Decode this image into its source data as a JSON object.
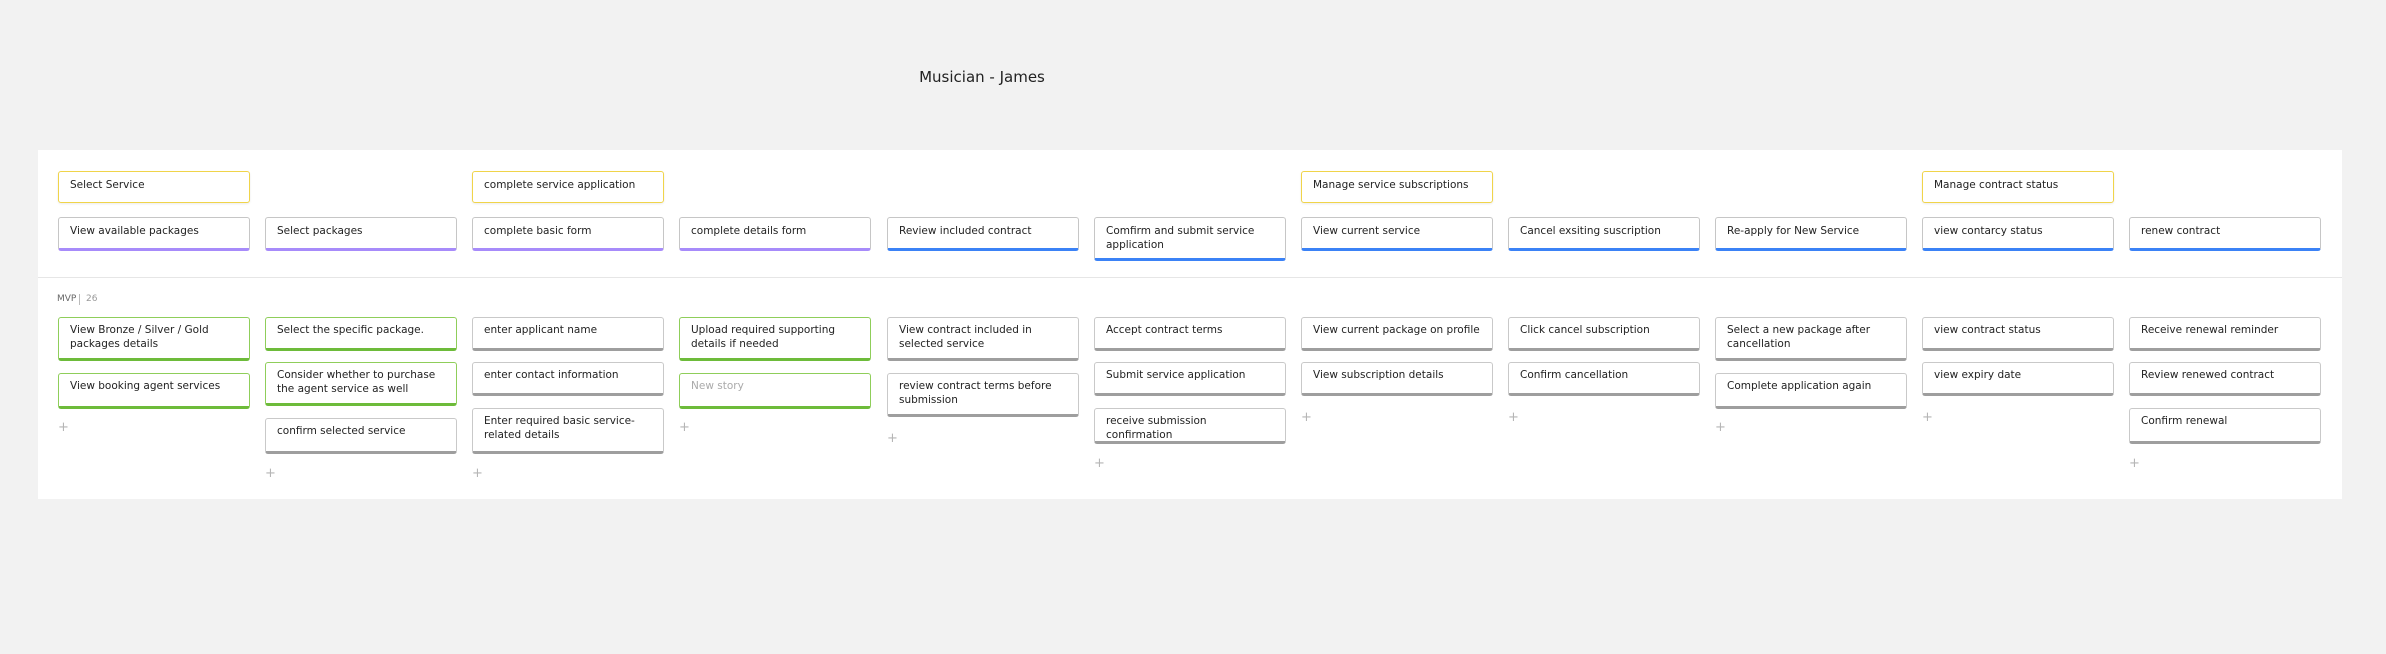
{
  "page_title": "Musician - James",
  "release": {
    "label": "MVP",
    "count": "26"
  },
  "activities": [
    "Select Service",
    "complete service application",
    "Manage service subscriptions",
    "Manage contract status"
  ],
  "steps": [
    "View available packages",
    "Select packages",
    "complete basic form",
    "complete details form",
    "Review included contract",
    "Comfirm and submit service application",
    "View current service",
    "Cancel exsiting suscription",
    "Re-apply for New Service",
    "view contarcy status",
    "renew contract"
  ],
  "stories": [
    [
      "View Bronze / Silver / Gold packages details",
      "View booking agent services"
    ],
    [
      "Select the specific package.",
      "Consider whether to purchase the agent service as well",
      "confirm selected service"
    ],
    [
      "enter applicant name",
      "enter contact information",
      "Enter required basic service-related details"
    ],
    [
      "Upload required supporting details if needed",
      "New story"
    ],
    [
      "View contract included in selected service",
      "review contract terms before submission"
    ],
    [
      "Accept contract terms",
      "Submit service application",
      "receive submission confirmation"
    ],
    [
      "View current package on profile",
      "View subscription details"
    ],
    [
      "Click cancel subscription",
      "Confirm cancellation"
    ],
    [
      "Select a new package after cancellation",
      "Complete application again"
    ],
    [
      "view contract status",
      "view expiry date"
    ],
    [
      "Receive renewal reminder",
      "Review renewed contract",
      "Confirm renewal"
    ]
  ],
  "add_symbol": "+",
  "colors": {
    "activity": "#f0d44a",
    "step_purple": "#a78bfa",
    "step_blue": "#3b82f6",
    "story_green": "#6dbb3a",
    "story_gray": "#9e9e9e"
  }
}
